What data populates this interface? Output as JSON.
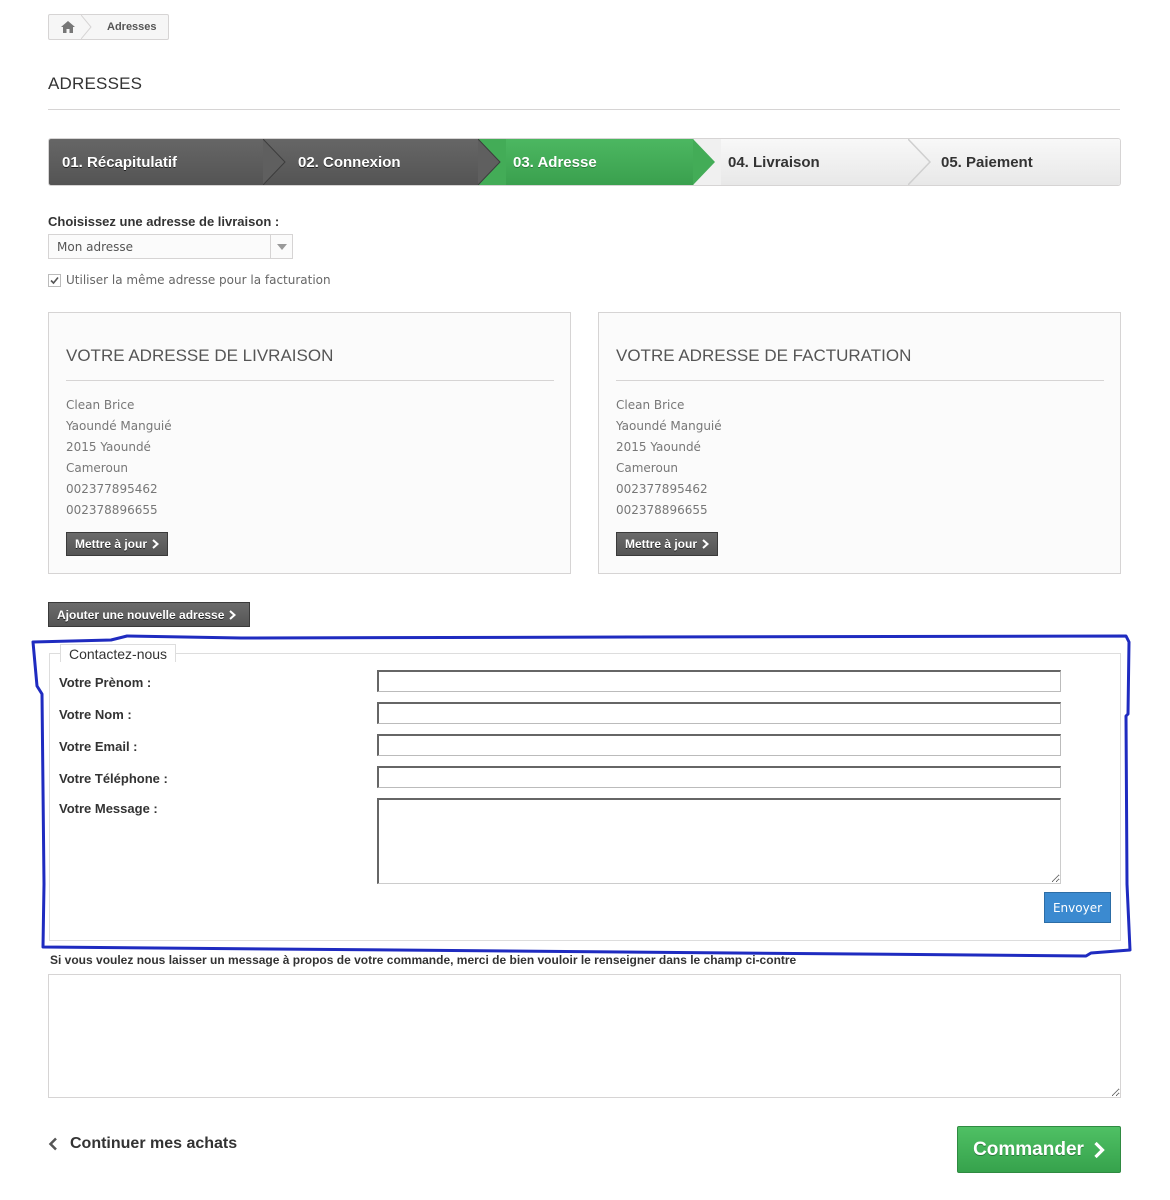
{
  "breadcrumb": {
    "home_icon": "home-icon",
    "current": "Adresses"
  },
  "page_title": "ADRESSES",
  "steps": [
    {
      "label": "01. Récapitulatif",
      "state": "done"
    },
    {
      "label": "02. Connexion",
      "state": "done"
    },
    {
      "label": "03. Adresse",
      "state": "active"
    },
    {
      "label": "04. Livraison",
      "state": "todo"
    },
    {
      "label": "05. Paiement",
      "state": "todo"
    }
  ],
  "delivery_choice": {
    "label": "Choisissez une adresse de livraison :",
    "selected": "Mon adresse",
    "same_billing_label": "Utiliser la même adresse pour la facturation",
    "same_billing_checked": true
  },
  "delivery_address": {
    "title": "VOTRE ADRESSE DE LIVRAISON",
    "lines": [
      "Clean Brice",
      "Yaoundé Manguié",
      "2015 Yaoundé",
      "Cameroun",
      "002377895462",
      "002378896655"
    ],
    "update_label": "Mettre à jour"
  },
  "billing_address": {
    "title": "VOTRE ADRESSE DE FACTURATION",
    "lines": [
      "Clean Brice",
      "Yaoundé Manguié",
      "2015 Yaoundé",
      "Cameroun",
      "002377895462",
      "002378896655"
    ],
    "update_label": "Mettre à jour"
  },
  "add_address_label": "Ajouter une nouvelle adresse",
  "contact": {
    "legend": "Contactez-nous",
    "firstname_label": "Votre Prènom :",
    "lastname_label": "Votre Nom :",
    "email_label": "Votre Email :",
    "phone_label": "Votre Téléphone :",
    "message_label": "Votre Message :",
    "firstname_value": "",
    "lastname_value": "",
    "email_value": "",
    "phone_value": "",
    "message_value": "",
    "send_label": "Envoyer"
  },
  "order_message": {
    "label": "Si vous voulez nous laisser un message à propos de votre commande, merci de bien vouloir le renseigner dans le champ ci-contre",
    "value": ""
  },
  "continue_label": "Continuer mes achats",
  "order_label": "Commander",
  "colors": {
    "step_done": "#5a5a5a",
    "step_active": "#43ac57",
    "step_todo": "#eeeeee",
    "send_button": "#3b8ad0",
    "order_button": "#43b157",
    "highlight": "#1f2bc0"
  }
}
